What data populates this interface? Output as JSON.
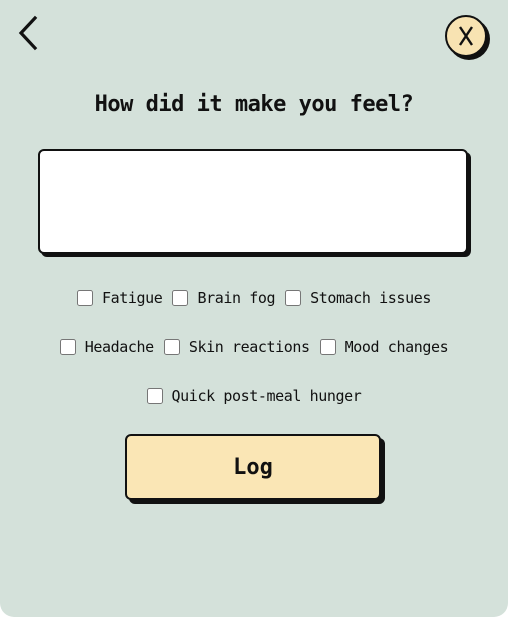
{
  "nav": {
    "back_icon": "chevron-left-icon",
    "close_icon": "close-icon"
  },
  "title": "How did it make you feel?",
  "note": {
    "value": "",
    "placeholder": ""
  },
  "symptoms": {
    "fatigue": "Fatigue",
    "brain_fog": "Brain fog",
    "stomach_issues": "Stomach issues",
    "headache": "Headache",
    "skin_reactions": "Skin reactions",
    "mood_changes": "Mood changes",
    "quick_hunger": "Quick post-meal hunger"
  },
  "log_label": "Log",
  "colors": {
    "background": "#d4e1da",
    "close_button": "#f8e3b2",
    "log_button": "#fae6b5",
    "outline": "#111111"
  }
}
